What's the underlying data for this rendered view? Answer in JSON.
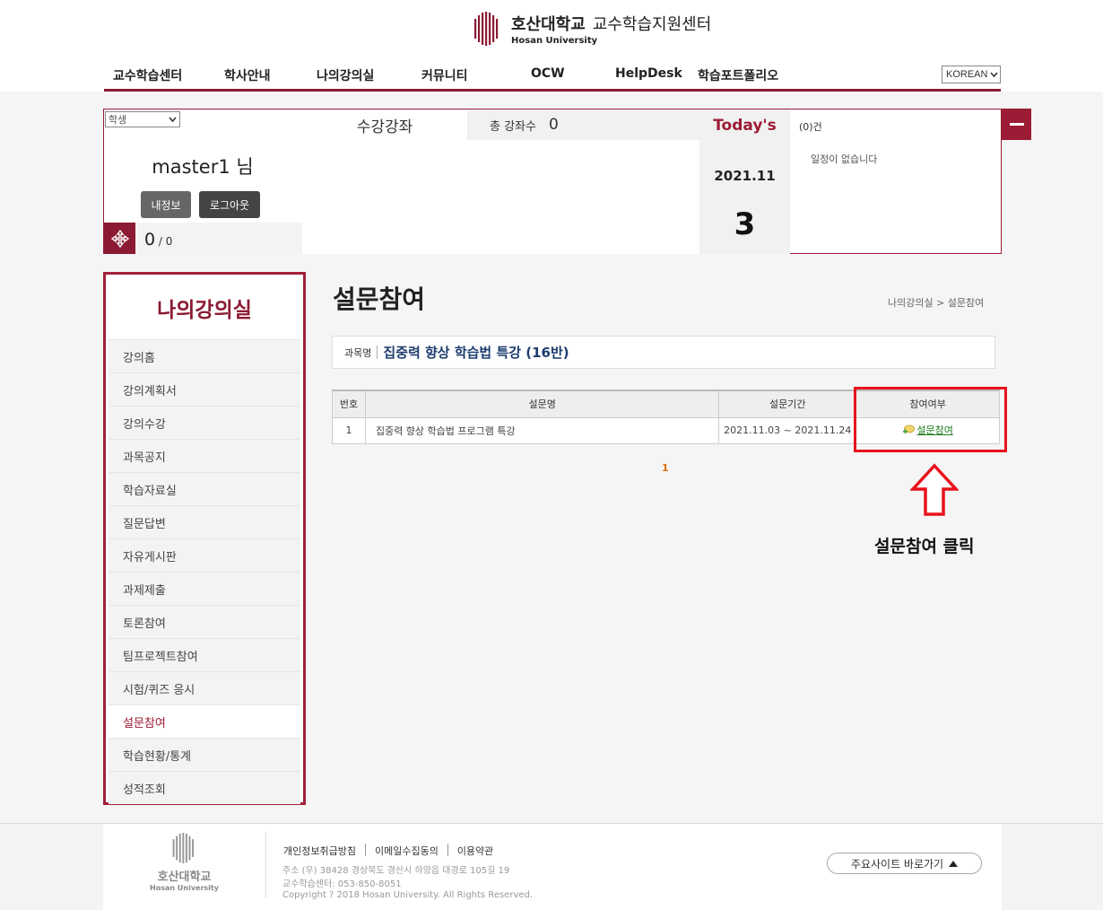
{
  "header": {
    "logo_kr": "호산대학교",
    "logo_center": "교수학습지원센터",
    "logo_en": "Hosan University",
    "nav": [
      {
        "label": "교수학습센터"
      },
      {
        "label": "학사안내"
      },
      {
        "label": "나의강의실"
      },
      {
        "label": "커뮤니티"
      },
      {
        "label": "OCW"
      },
      {
        "label": "HelpDesk"
      },
      {
        "label": "학습포트폴리오"
      }
    ],
    "language": "KOREAN"
  },
  "dashboard": {
    "role": "학생",
    "user_name": "master1",
    "user_suffix": "님",
    "my_info_label": "내정보",
    "logout_label": "로그아웃",
    "points": "0",
    "points_total": " / 0",
    "course_heading": "수강강좌",
    "course_count_label": "총 강좌수",
    "course_count": "0",
    "today_label": "Today's",
    "schedule_count": "(0)건",
    "date_ym": "2021.11",
    "date_day": "3",
    "schedule_empty": "일정이 없습니다"
  },
  "sidebar": {
    "title": "나의강의실",
    "items": [
      {
        "label": "강의홈"
      },
      {
        "label": "강의계획서"
      },
      {
        "label": "강의수강"
      },
      {
        "label": "과목공지"
      },
      {
        "label": "학습자료실"
      },
      {
        "label": "질문답변"
      },
      {
        "label": "자유게시판"
      },
      {
        "label": "과제제출"
      },
      {
        "label": "토론참여"
      },
      {
        "label": "팀프로젝트참여"
      },
      {
        "label": "시험/퀴즈 응시"
      },
      {
        "label": "설문참여"
      },
      {
        "label": "학습현황/통계"
      },
      {
        "label": "성적조회"
      }
    ],
    "active_index": 11
  },
  "content": {
    "page_title": "설문참여",
    "breadcrumb": "나의강의실 > 설문참여",
    "course_label": "과목명",
    "course_name": "집중력 향상 학습법 특강 (16반)",
    "table": {
      "headers": [
        "번호",
        "설문명",
        "설문기간",
        "참여여부"
      ],
      "rows": [
        {
          "no": "1",
          "title": "집중력 향상 학습법 프로그램 특강",
          "period": "2021.11.03 ~ 2021.11.24",
          "action": "설문참여"
        }
      ]
    },
    "pagination": [
      "1"
    ],
    "instruction": "설문참여 클릭"
  },
  "footer": {
    "logo_kr": "호산대학교",
    "logo_en": "Hosan University",
    "links": [
      "개인정보취급방침",
      "이메일수집동의",
      "이용약관"
    ],
    "address": "주소 (우) 38428 경상북도 경산시 하양읍 대경로 105길 19",
    "phone": "교수학습센터: 053-850-8051",
    "copyright": "Copyright ? 2018 Hosan University. All Rights Reserved.",
    "sites_label": "주요사이트 바로가기"
  },
  "colors": {
    "brand": "#8b1a32",
    "highlight": "#e8121c",
    "link": "#1c7c1c",
    "course_name": "#1d3c6e"
  }
}
